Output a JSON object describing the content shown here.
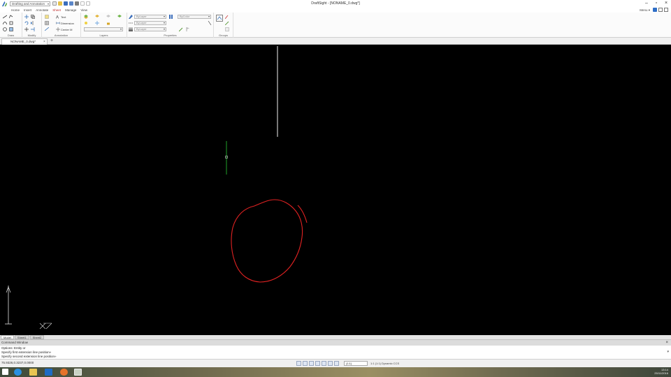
{
  "window": {
    "title": "DraftSight - [NONAME_0.dwg*]",
    "workspace": "Drafting and Annotation",
    "user_menu": "Menu ▾"
  },
  "ribbon": {
    "tabs": [
      "Home",
      "Insert",
      "Annotate",
      "Sheet",
      "Manage",
      "View"
    ],
    "active_tab": "Sheet",
    "groups": [
      "Draw",
      "Modify",
      "Annotation",
      "Layers",
      "Properties",
      "Groups"
    ],
    "labels": {
      "text": "Text",
      "dimension": "Dimension",
      "center_mark": "Center M"
    },
    "properties": {
      "layer": "ByLayer",
      "linestyle": "ByLayer",
      "color": "ByColor",
      "lineweight": "ByLayer"
    }
  },
  "document": {
    "tab_label": "NONAME_0.dwg*"
  },
  "layout_tabs": [
    "Model",
    "Sheet1",
    "Sheet2"
  ],
  "active_layout": "Model",
  "command": {
    "header": "Command Window",
    "lines": [
      "Options: Entity or",
      "Specify first extension line position»",
      "Specify second extension line position»"
    ]
  },
  "status": {
    "coords": "75.9326,0.3237,0.0000",
    "annotation_scale": "(1:1)",
    "scale_text": "1:1 (1:1)  Dynamic CCS"
  },
  "taskbar": {
    "time": "13:14",
    "date": "25/11/2016"
  },
  "colors": {
    "canvas": "#000000",
    "drawn_line": "#c8c8c8",
    "crosshair": "#1fa02a",
    "sketch_circle": "#e12222",
    "ucs": "#e0e0e0"
  }
}
